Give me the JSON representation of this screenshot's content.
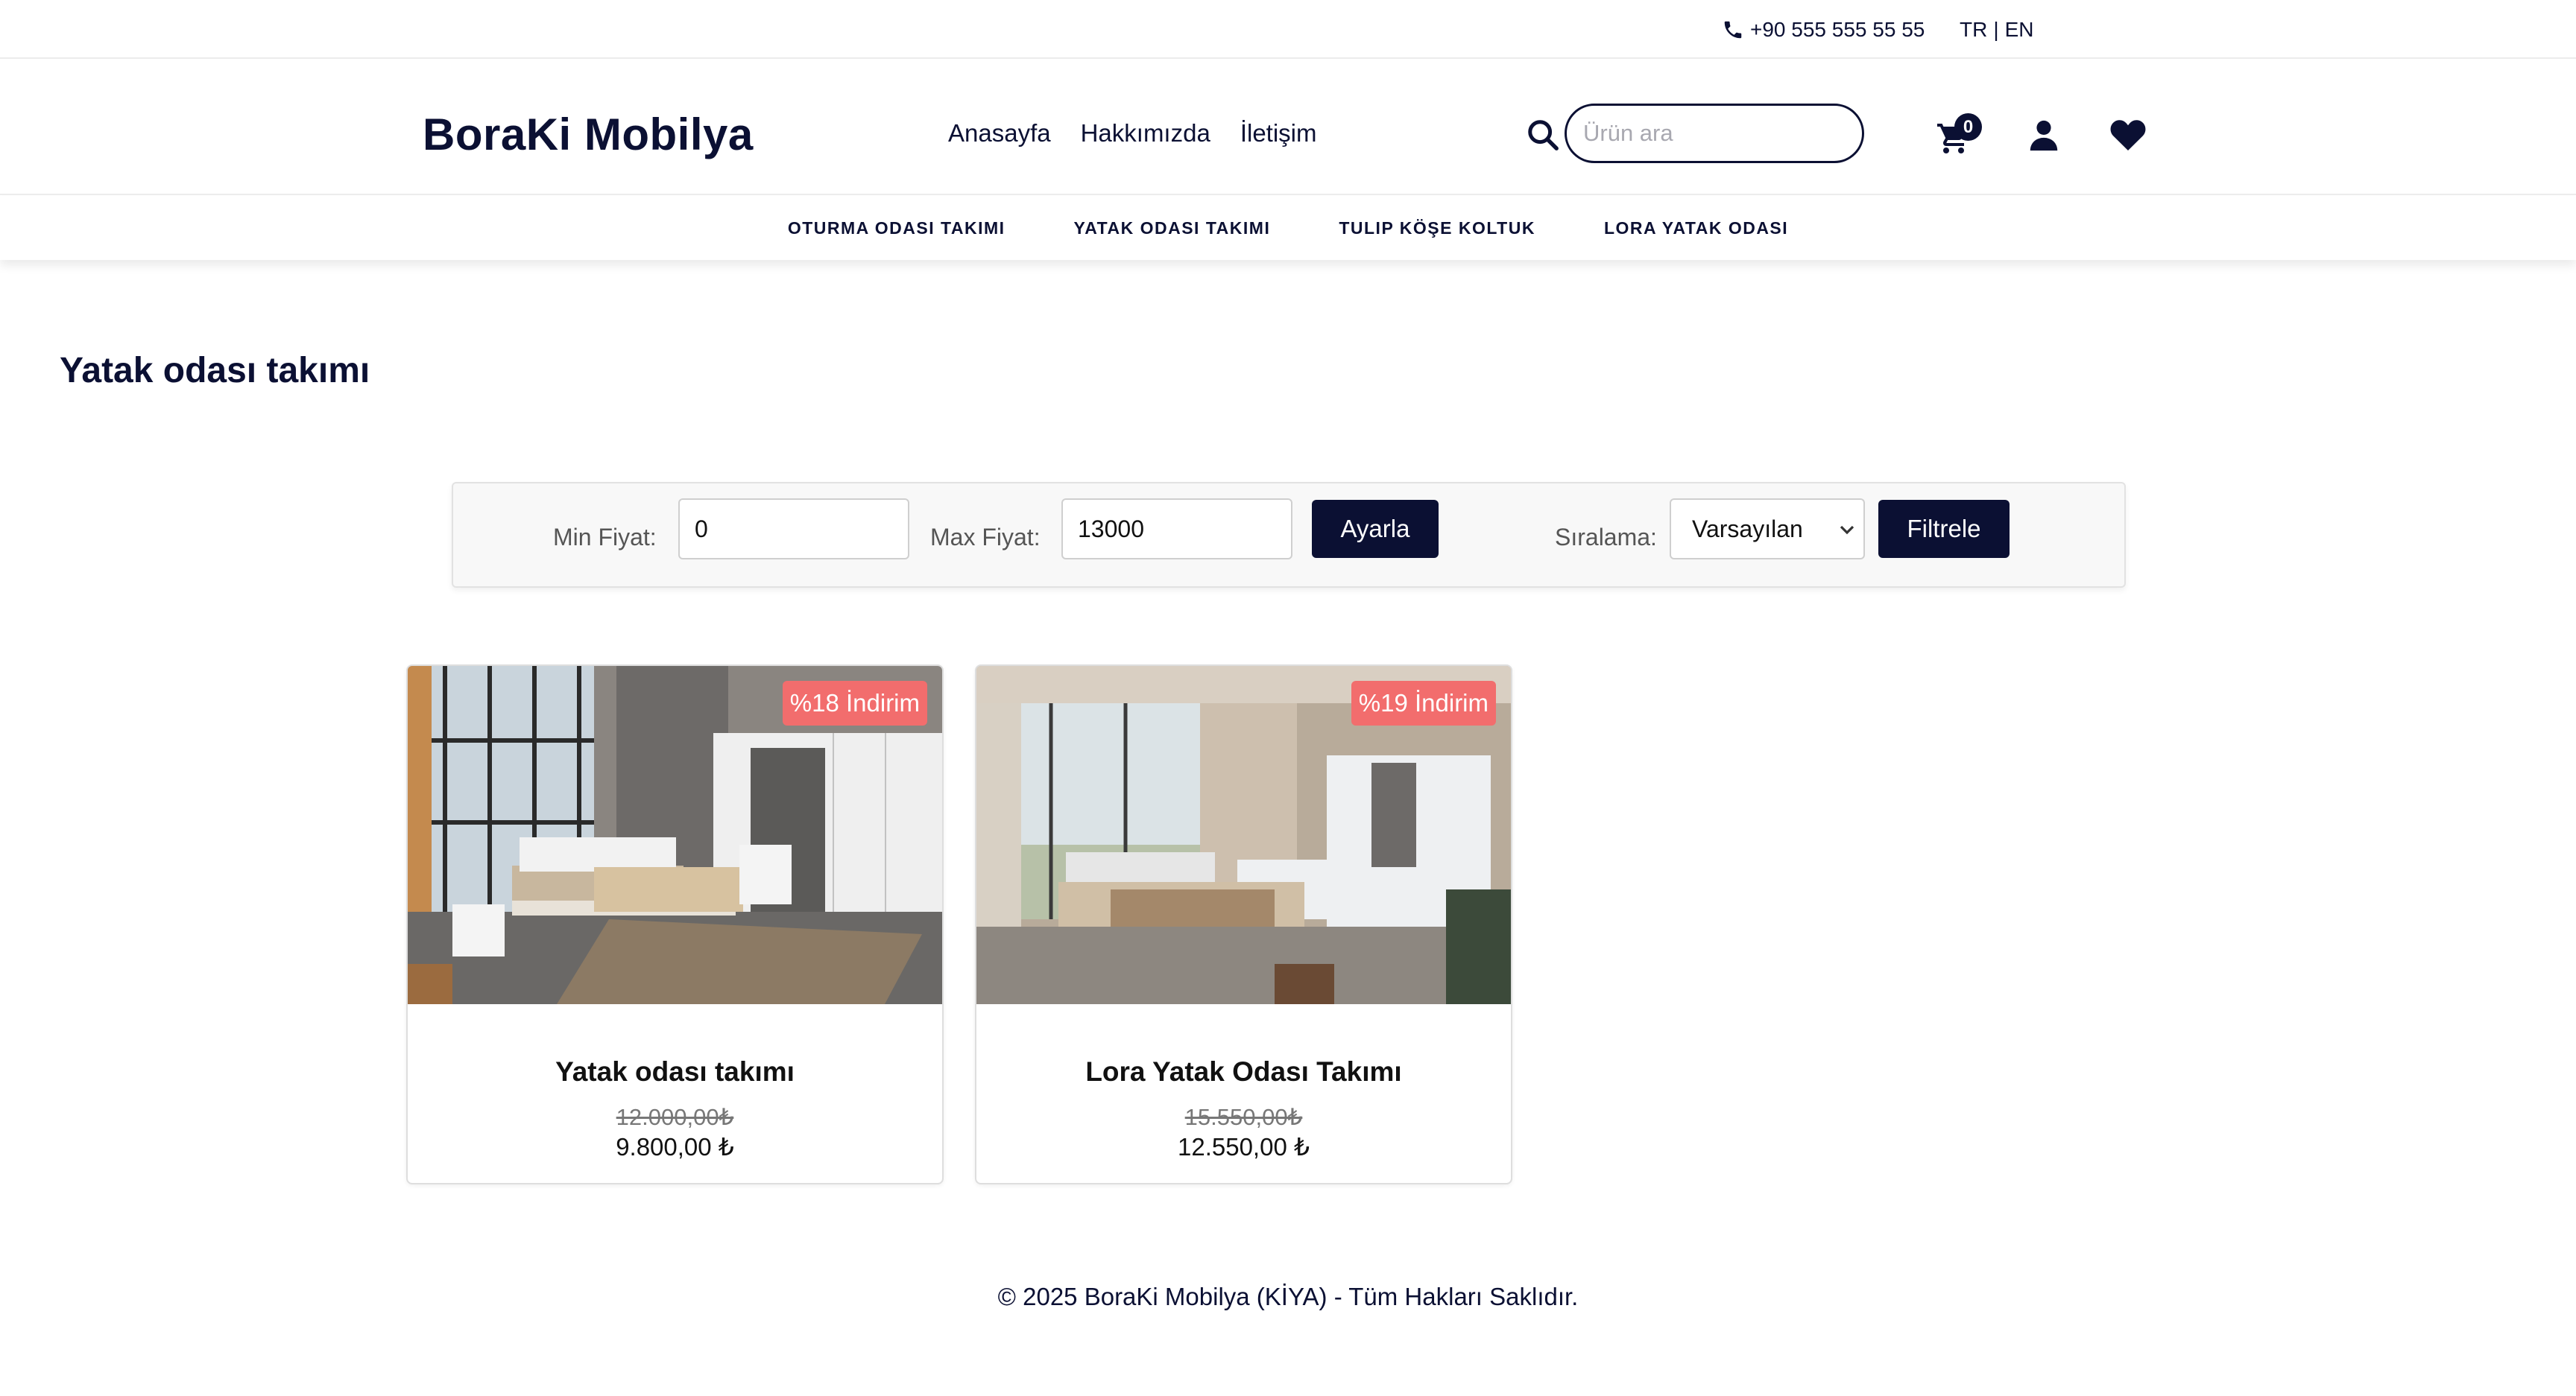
{
  "topbar": {
    "phone": "+90 555 555 55 55",
    "lang_tr": "TR",
    "lang_sep": "|",
    "lang_en": "EN"
  },
  "header": {
    "logo": "BoraKi Mobilya",
    "nav": [
      "Anasayfa",
      "Hakkımızda",
      "İletişim"
    ],
    "search_placeholder": "Ürün ara",
    "cart_count": "0",
    "icons": [
      "search-icon",
      "cart-icon",
      "user-icon",
      "heart-icon"
    ]
  },
  "categories": [
    "OTURMA ODASI TAKIMI",
    "YATAK ODASI TAKIMI",
    "TULIP KÖŞE KOLTUK",
    "LORA YATAK ODASI"
  ],
  "page_title": "Yatak odası takımı",
  "filter": {
    "min_label": "Min Fiyat:",
    "min_value": "0",
    "max_label": "Max Fiyat:",
    "max_value": "13000",
    "apply_label": "Ayarla",
    "sort_label": "Sıralama:",
    "sort_selected": "Varsayılan",
    "filter_label": "Filtrele"
  },
  "products": [
    {
      "name": "Yatak odası takımı",
      "badge": "%18 İndirim",
      "old_price": "12.000,00₺",
      "price": "9.800,00 ₺"
    },
    {
      "name": "Lora Yatak Odası Takımı",
      "badge": "%19 İndirim",
      "old_price": "15.550,00₺",
      "price": "12.550,00 ₺"
    }
  ],
  "colors": {
    "primary": "#0b1033",
    "discount_badge": "#f26d6d",
    "filter_bg": "#f8f8f8"
  },
  "footer": "© 2025 BoraKi Mobilya (KİYA) - Tüm Hakları Saklıdır."
}
